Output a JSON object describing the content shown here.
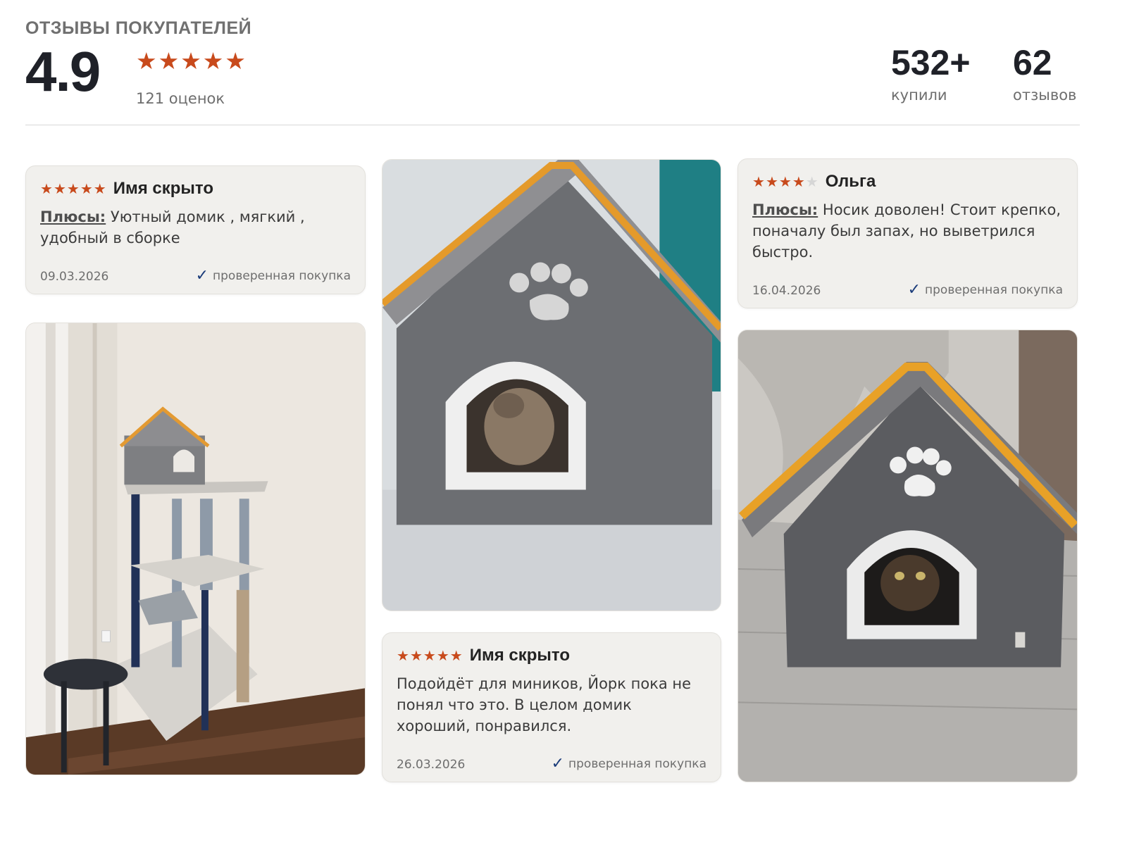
{
  "header": {
    "title": "ОТЗЫВЫ ПОКУПАТЕЛЕЙ",
    "rating": "4.9",
    "stars": 5,
    "ratings_count": "121 оценок",
    "bought_value": "532+",
    "bought_label": "купили",
    "reviews_value": "62",
    "reviews_label": "отзывов"
  },
  "colors": {
    "star": "#c84a1c",
    "check": "#1b3c7a",
    "card_bg": "#f1f0ed"
  },
  "icons": {
    "star": "star-icon",
    "check": "checkmark-icon"
  },
  "reviews": [
    {
      "stars": 5,
      "author": "Имя скрыто",
      "pros_label": "Плюсы:",
      "text": "Уютный домик , мягкий , удобный в сборке",
      "date": "09.03.2026",
      "verified": "проверенная покупка"
    },
    {
      "stars": 5,
      "author": "Имя скрыто",
      "text": "Подойдёт для миников, Йорк пока не понял что это. В целом домик хороший, понравился.",
      "date": "26.03.2026",
      "verified": "проверенная покупка"
    },
    {
      "stars": 4,
      "author": "Ольга",
      "pros_label": "Плюсы:",
      "text": "Носик доволен! Стоит крепко, поначалу был запах, но выветрился быстро.",
      "date": "16.04.2026",
      "verified": "проверенная покупка"
    }
  ]
}
